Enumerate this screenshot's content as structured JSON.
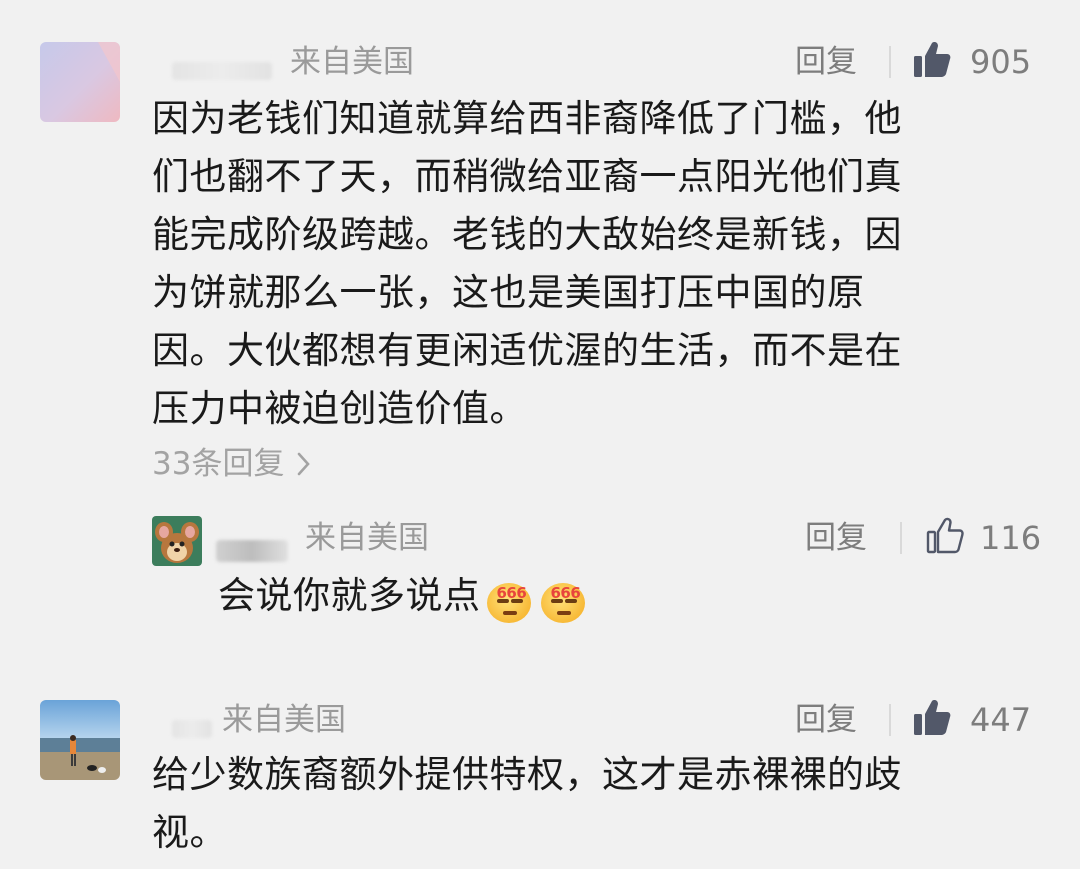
{
  "comments": [
    {
      "location": "来自美国",
      "reply_label": "回复",
      "like_count": "905",
      "like_icon_style": "filled",
      "body_lines": [
        "因为老钱们知道就算给西非裔降低了门槛，他",
        "们也翻不了天，而稍微给亚裔一点阳光他们真",
        "能完成阶级跨越。老钱的大敌始终是新钱，因",
        "为饼就那么一张，这也是美国打压中国的原",
        "因。大伙都想有更闲适优渥的生活，而不是在",
        "压力中被迫创造价值。"
      ],
      "more_replies": "33条回复",
      "avatar_colors": [
        "#c9cbe8",
        "#eac0c8"
      ]
    },
    {
      "location": "来自美国",
      "reply_label": "回复",
      "like_count": "116",
      "like_icon_style": "outline",
      "body_text": "会说你就多说点",
      "emoji_name": "666-smirk-emoji",
      "emoji_label": "666"
    },
    {
      "location": "来自美国",
      "reply_label": "回复",
      "like_count": "447",
      "like_icon_style": "filled",
      "body_lines": [
        "给少数族裔额外提供特权，这才是赤裸裸的歧",
        "视。"
      ]
    }
  ],
  "colors": {
    "background": "#f1f1f1",
    "text": "#1a1a1a",
    "meta": "#9a9a9a",
    "action": "#7d7d7d",
    "link": "#a3a3a3",
    "like_icon": "#525869"
  },
  "icons": [
    "thumbs-up-filled-icon",
    "thumbs-up-outline-icon",
    "chevron-right-icon"
  ]
}
